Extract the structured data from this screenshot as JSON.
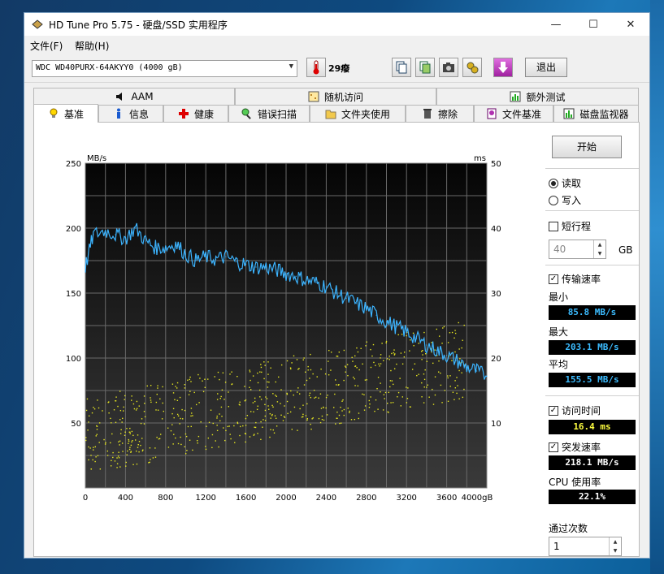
{
  "window": {
    "title": "HD Tune Pro 5.75 - 硬盘/SSD 实用程序",
    "minimize": "—",
    "maximize": "☐",
    "close": "✕"
  },
  "menu": {
    "file": "文件(F)",
    "help": "帮助(H)"
  },
  "toolbar": {
    "drive": "WDC WD40PURX-64AKYY0 (4000 gB)",
    "temperature": "29癈",
    "exit_label": "退出"
  },
  "tabs_top": [
    "AAM",
    "随机访问",
    "额外测试"
  ],
  "tabs_bottom": [
    "基准",
    "信息",
    "健康",
    "错误扫描",
    "文件夹使用",
    "擦除",
    "文件基准",
    "磁盘监视器"
  ],
  "side": {
    "start_label": "开始",
    "read_label": "读取",
    "write_label": "写入",
    "short_stroke_label": "短行程",
    "short_stroke_value": "40",
    "short_stroke_unit": "GB",
    "transfer_label": "传输速率",
    "min_label": "最小",
    "min_value": "85.8 MB/s",
    "max_label": "最大",
    "max_value": "203.1 MB/s",
    "avg_label": "平均",
    "avg_value": "155.5 MB/s",
    "access_label": "访问时间",
    "access_value": "16.4 ms",
    "burst_label": "突发速率",
    "burst_value": "218.1 MB/s",
    "cpu_label": "CPU 使用率",
    "cpu_value": "22.1%",
    "passes_label": "通过次数",
    "passes_value": "1"
  },
  "colors": {
    "transfer": "#3cb4ff",
    "access": "#e8e820",
    "grid": "#6a6a6a"
  },
  "chart_data": {
    "type": "line",
    "ylabel_left": "MB/s",
    "ylabel_right": "ms",
    "xlabel_unit": "gB",
    "xlim": [
      0,
      4000
    ],
    "ylim_left": [
      0,
      250
    ],
    "ylim_right": [
      0,
      50
    ],
    "x_ticks": [
      "0",
      "400",
      "800",
      "1200",
      "1600",
      "2000",
      "2400",
      "2800",
      "3200",
      "3600",
      "4000gB"
    ],
    "y_ticks_left": [
      "50",
      "100",
      "150",
      "200",
      "250"
    ],
    "y_ticks_right": [
      "10",
      "20",
      "30",
      "40",
      "50"
    ],
    "grid": true,
    "series": [
      {
        "name": "传输速率",
        "x": [
          0,
          80,
          200,
          300,
          400,
          500,
          600,
          700,
          800,
          900,
          1000,
          1100,
          1200,
          1300,
          1400,
          1500,
          1600,
          1700,
          1800,
          1900,
          2000,
          2100,
          2200,
          2300,
          2400,
          2500,
          2600,
          2700,
          2800,
          2900,
          3000,
          3100,
          3200,
          3300,
          3400,
          3500,
          3600,
          3700,
          3800,
          3900,
          4000
        ],
        "y": [
          170,
          195,
          198,
          195,
          192,
          200,
          190,
          185,
          185,
          188,
          180,
          175,
          178,
          176,
          178,
          174,
          172,
          170,
          170,
          168,
          165,
          163,
          160,
          158,
          155,
          150,
          146,
          142,
          138,
          133,
          128,
          124,
          120,
          115,
          110,
          106,
          102,
          98,
          93,
          90,
          86
        ]
      },
      {
        "name": "访问时间",
        "scatter": true
      }
    ]
  }
}
